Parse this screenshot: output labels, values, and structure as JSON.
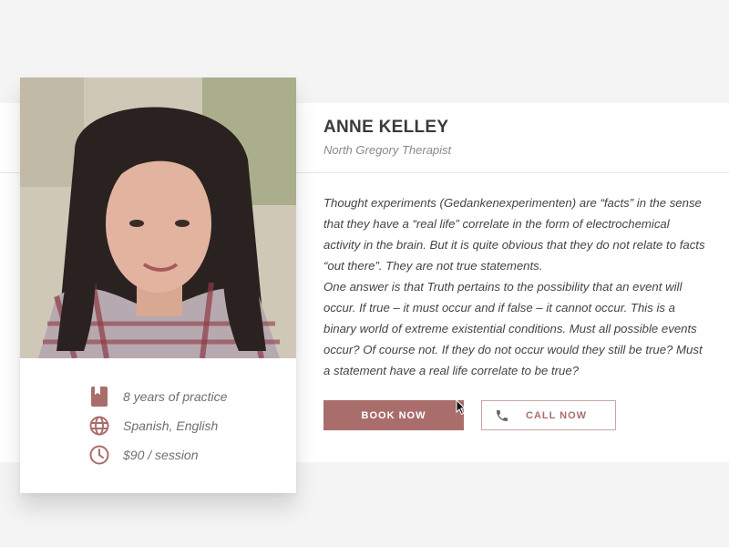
{
  "profile": {
    "name": "ANNE KELLEY",
    "subtitle": "North Gregory Therapist",
    "bio": [
      "Thought experiments (Gedankenexperimenten) are “facts” in the sense that they have a “real life” correlate in the form of electrochemical activity in the brain. But it is quite obvious that they do not relate to facts “out there”. They are not true statements.",
      "One answer is that Truth pertains to the possibility that an event will occur. If true – it must occur and if false – it cannot occur. This is a binary world of extreme existential conditions. Must all possible events occur? Of course not. If they do not occur would they still be true? Must a statement have a real life correlate to be true?"
    ]
  },
  "facts": [
    {
      "icon": "book-icon",
      "text": "8 years of practice"
    },
    {
      "icon": "globe-icon",
      "text": "Spanish, English"
    },
    {
      "icon": "clock-icon",
      "text": "$90 / session"
    }
  ],
  "actions": {
    "book_label": "BOOK NOW",
    "call_label": "CALL NOW"
  },
  "colors": {
    "accent": "#a96e6c",
    "page_bg": "#f4f4f4",
    "band_bg": "#ffffff",
    "text_dark": "#3a3a3a",
    "text_muted": "#8a8a8a"
  }
}
